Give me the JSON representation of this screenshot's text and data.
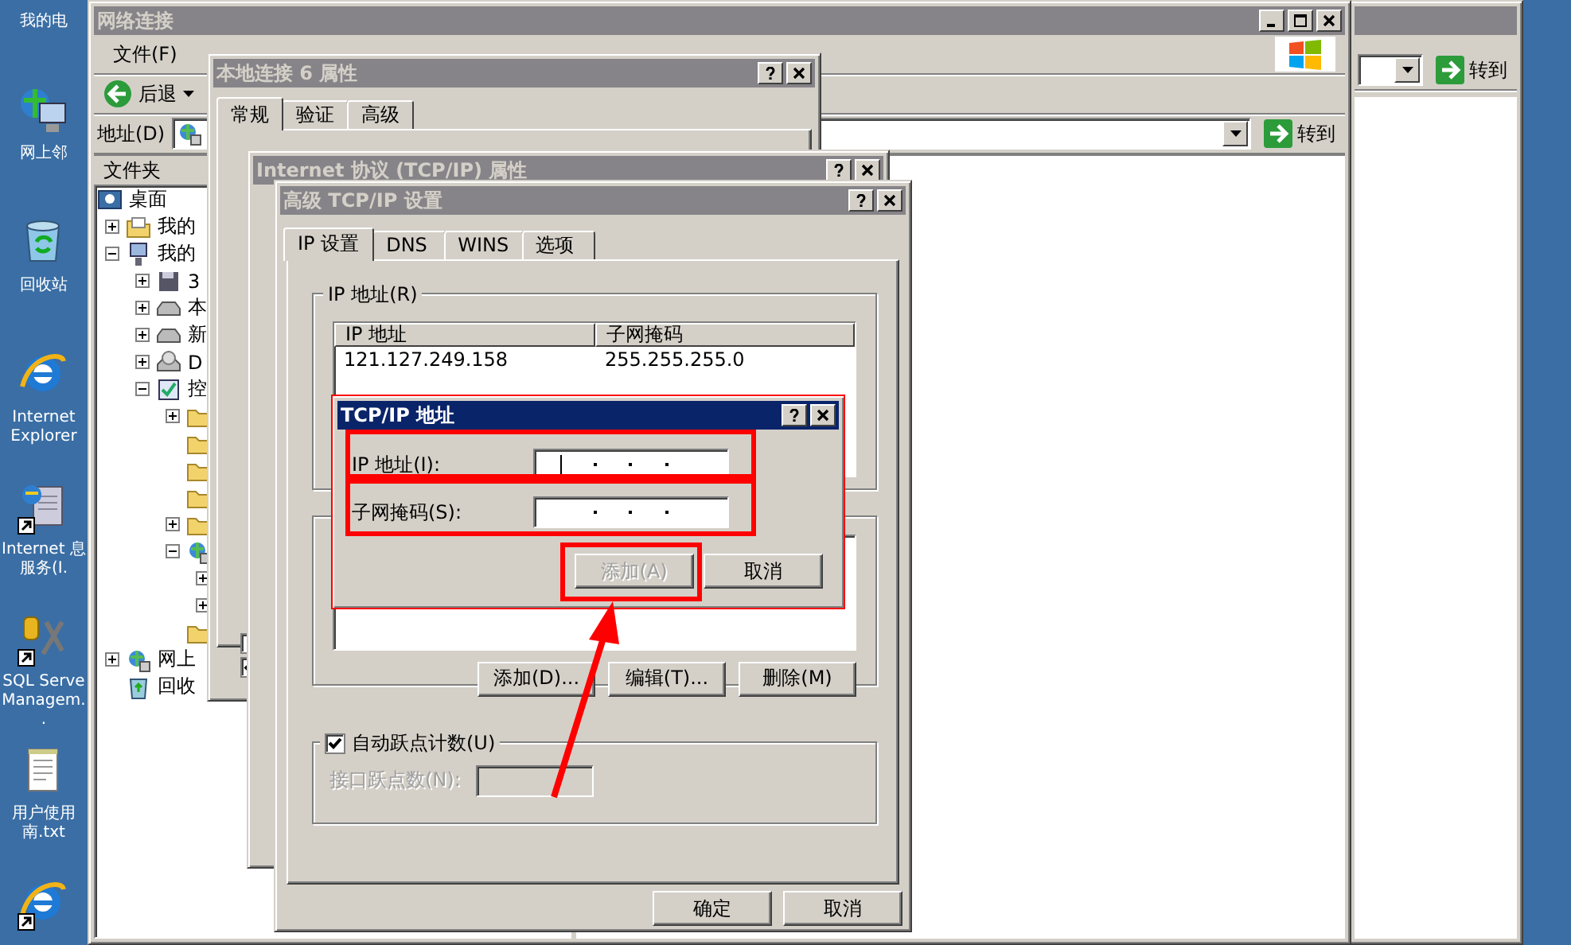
{
  "desktop": {
    "icons": [
      {
        "label": "我的电",
        "kind": "computer",
        "shortcut": false
      },
      {
        "label": "网上邻",
        "kind": "network",
        "shortcut": false
      },
      {
        "label": "回收站",
        "kind": "recycle",
        "shortcut": false
      },
      {
        "label": "Internet Explorer",
        "kind": "ie",
        "shortcut": false
      },
      {
        "label": "Internet 息服务(I.",
        "kind": "server",
        "shortcut": true
      },
      {
        "label": "SQL Serve Managem..",
        "kind": "tools",
        "shortcut": true
      },
      {
        "label": "用户使用南.txt",
        "kind": "text",
        "shortcut": false
      },
      {
        "kind": "ie",
        "shortcut": true
      }
    ]
  },
  "explorer": {
    "title": "网络连接",
    "menu": [
      "文件(F)"
    ],
    "back_button": "后退",
    "address_label": "地址(D)",
    "go_button": "转到",
    "folders_header": "文件夹",
    "tree": [
      {
        "label": "桌面",
        "kind": "desktop",
        "children": [
          {
            "label": "我的",
            "kind": "documents",
            "expanded": false
          },
          {
            "label": "我的",
            "kind": "computer",
            "expanded": true,
            "children": [
              {
                "label": "3",
                "kind": "floppy",
                "expanded": false
              },
              {
                "label": "本",
                "kind": "drive",
                "expanded": false
              },
              {
                "label": "新",
                "kind": "drive",
                "expanded": false
              },
              {
                "label": "D",
                "kind": "cd",
                "expanded": false
              },
              {
                "label": "控",
                "kind": "control",
                "expanded": true,
                "children": [
                  {
                    "kind": "folder",
                    "expanded": false
                  },
                  {
                    "kind": "folder"
                  },
                  {
                    "kind": "folder"
                  },
                  {
                    "kind": "folder"
                  },
                  {
                    "kind": "folder",
                    "expanded": false
                  },
                  {
                    "kind": "network",
                    "expanded": true,
                    "children": [
                      {
                        "expanded": false
                      },
                      {
                        "expanded": false
                      }
                    ]
                  },
                  {
                    "kind": "folder"
                  }
                ]
              }
            ]
          },
          {
            "label": "网上",
            "kind": "network",
            "expanded": false
          },
          {
            "label": "回收",
            "kind": "recycle"
          }
        ]
      }
    ]
  },
  "back_window": {
    "go_button": "转到"
  },
  "properties_dialog": {
    "title": "本地连接 6 属性",
    "tabs": [
      {
        "label": "常规",
        "selected": true
      },
      {
        "label": "验证",
        "selected": false
      },
      {
        "label": "高级",
        "selected": false
      }
    ],
    "checkboxes": [
      {
        "checked": false
      },
      {
        "checked": true
      }
    ]
  },
  "tcpip_dialog": {
    "title": "Internet 协议 (TCP/IP) 属性"
  },
  "advanced_dialog": {
    "title": "高级 TCP/IP 设置",
    "tabs": [
      {
        "label": "IP 设置",
        "selected": true
      },
      {
        "label": "DNS",
        "selected": false
      },
      {
        "label": "WINS",
        "selected": false
      },
      {
        "label": "选项",
        "selected": false
      }
    ],
    "ip_group": {
      "legend": "IP 地址(R)",
      "columns": [
        "IP 地址",
        "子网掩码"
      ],
      "rows": [
        [
          "121.127.249.158",
          "255.255.255.0"
        ]
      ]
    },
    "gateway_group": {
      "buttons": [
        {
          "label": "添加(D)...",
          "disabled": false
        },
        {
          "label": "编辑(T)...",
          "disabled": false
        },
        {
          "label": "删除(M)",
          "disabled": false
        }
      ]
    },
    "metric_group": {
      "checkbox": {
        "label": "自动跃点计数(U)",
        "checked": true
      },
      "field_label": "接口跃点数(N):",
      "field_disabled": true
    },
    "buttons": [
      "确定",
      "取消"
    ]
  },
  "address_dialog": {
    "title": "TCP/IP 地址",
    "fields": [
      {
        "label": "IP 地址(I):",
        "focused": true
      },
      {
        "label": "子网掩码(S):",
        "focused": false
      }
    ],
    "buttons": [
      {
        "label": "添加(A)",
        "disabled": true
      },
      {
        "label": "取消",
        "disabled": false
      }
    ]
  }
}
